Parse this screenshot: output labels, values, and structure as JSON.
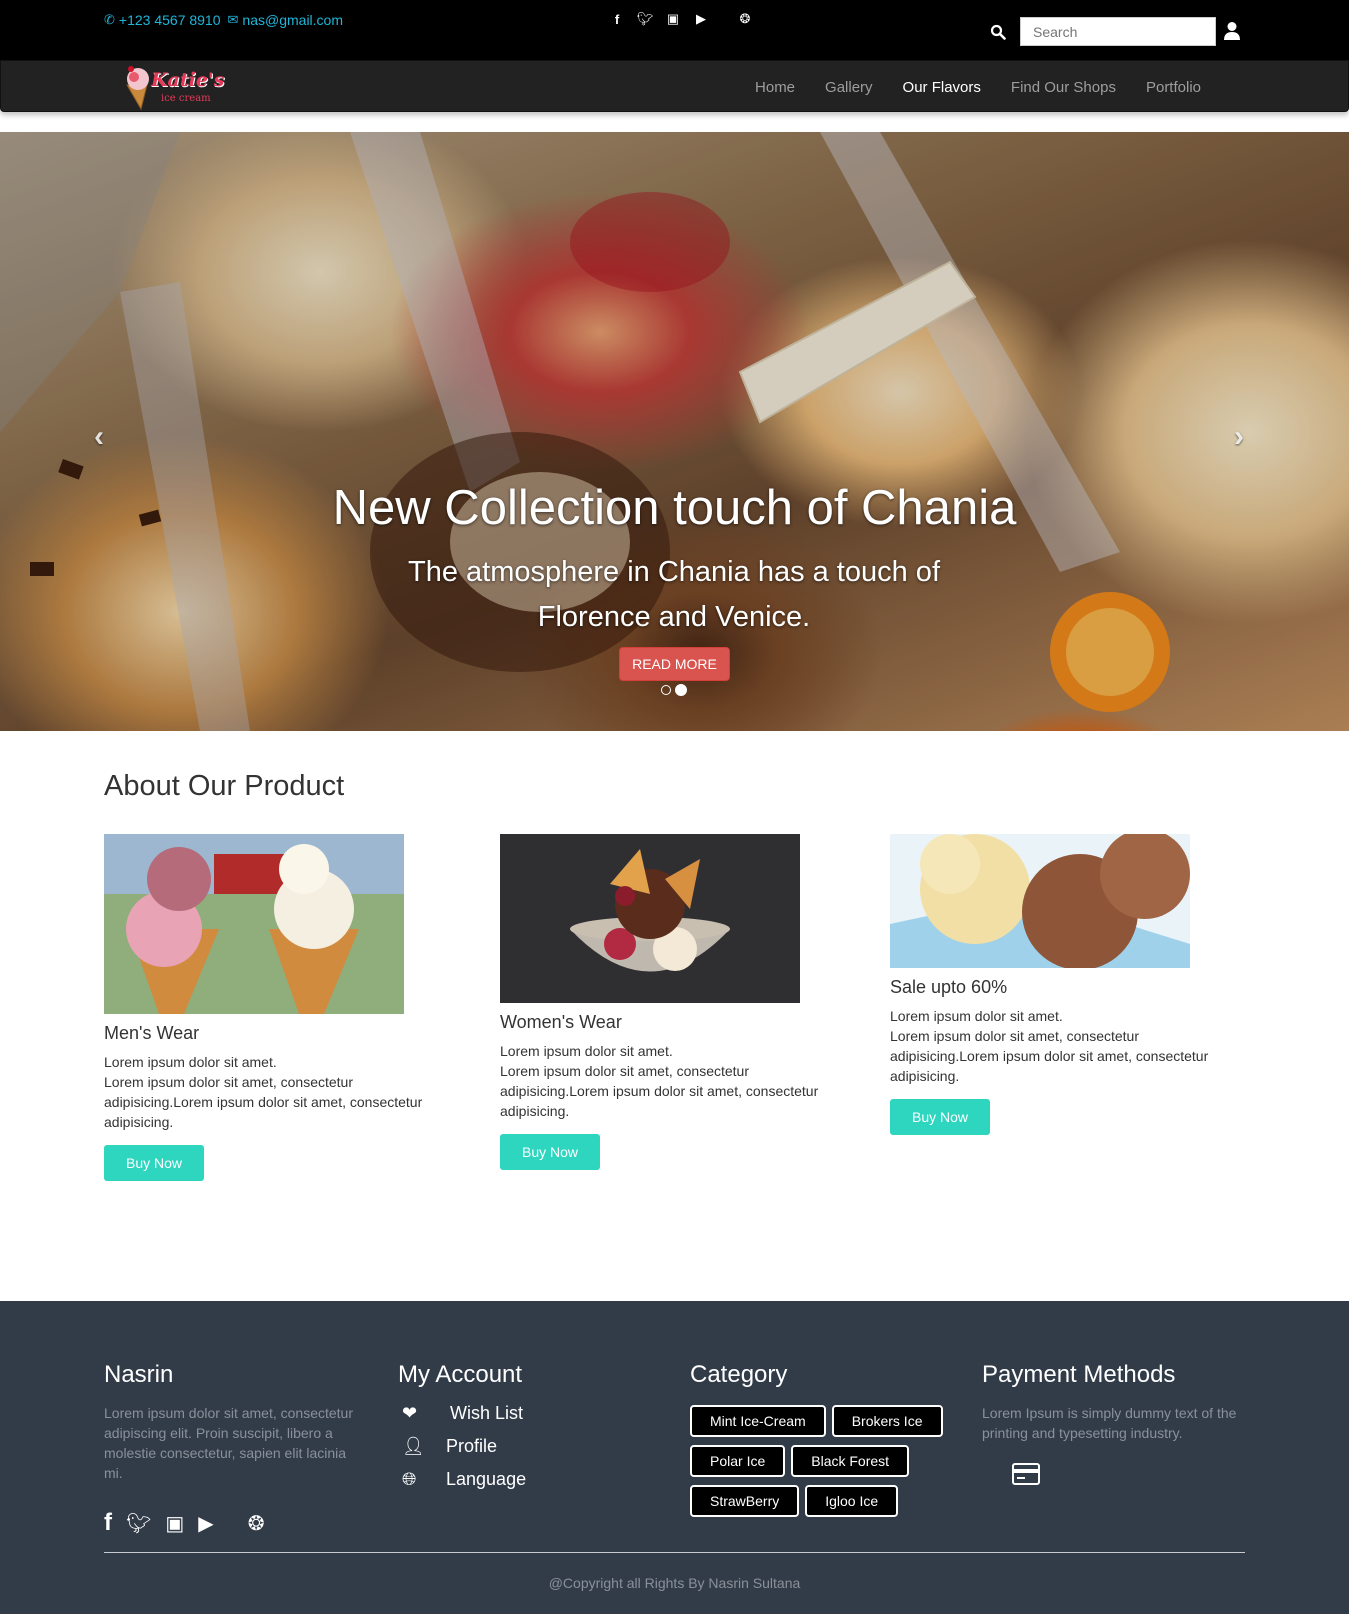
{
  "topbar": {
    "phone": "+123 4567 8910",
    "email": "nas@gmail.com",
    "social_icons": [
      "facebook-icon",
      "twitter-icon",
      "instagram-icon",
      "youtube-icon",
      "dribbble-icon"
    ],
    "search_placeholder": "Search"
  },
  "navbar": {
    "logo_line1": "Katie's",
    "logo_line2": "ice cream",
    "links": [
      "Home",
      "Gallery",
      "Our Flavors",
      "Find Our Shops",
      "Portfolio"
    ],
    "active": "Our Flavors"
  },
  "hero": {
    "title": "New Collection touch of Chania",
    "subtitle": "The atmosphere in Chania has a touch of Florence and Venice.",
    "button": "READ MORE",
    "slides": 2,
    "active_slide": 2
  },
  "about": {
    "title": "About Our Product",
    "cards": [
      {
        "title": "Men's Wear",
        "line1": "Lorem ipsum dolor sit amet.",
        "line2": "Lorem ipsum dolor sit amet, consectetur adipisicing.Lorem ipsum dolor sit amet, consectetur adipisicing.",
        "button": "Buy Now"
      },
      {
        "title": "Women's Wear",
        "line1": "Lorem ipsum dolor sit amet.",
        "line2": "Lorem ipsum dolor sit amet, consectetur adipisicing.Lorem ipsum dolor sit amet, consectetur adipisicing.",
        "button": "Buy Now"
      },
      {
        "title": "Sale upto 60%",
        "line1": "Lorem ipsum dolor sit amet.",
        "line2": "Lorem ipsum dolor sit amet, consectetur adipisicing.Lorem ipsum dolor sit amet, consectetur adipisicing.",
        "button": "Buy Now"
      }
    ]
  },
  "footer": {
    "col1": {
      "title": "Nasrin",
      "text": "Lorem ipsum dolor sit amet, consectetur adipiscing elit. Proin suscipit, libero a molestie consectetur, sapien elit lacinia mi."
    },
    "col2": {
      "title": "My Account",
      "items": [
        "Wish List",
        "Profile",
        "Language"
      ]
    },
    "col3": {
      "title": "Category",
      "tags": [
        "Mint Ice-Cream",
        "Brokers Ice",
        "Polar Ice",
        "Black Forest",
        "StrawBerry",
        "Igloo Ice"
      ]
    },
    "col4": {
      "title": "Payment Methods",
      "text": "Lorem Ipsum is simply dummy text of the printing and typesetting industry."
    },
    "copyright": "@Copyright all Rights By Nasrin Sultana"
  },
  "colors": {
    "accent": "#2ed6bf",
    "contact": "#1fb6d9",
    "hero_button": "#d9534f",
    "footer_bg": "#323c49"
  }
}
